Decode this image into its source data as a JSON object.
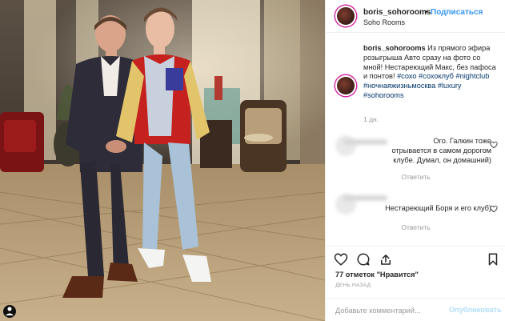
{
  "post_header": {
    "username": "boris_sohorooms",
    "separator": "•",
    "follow_label": "Подписаться",
    "location": "Soho Rooms"
  },
  "caption": {
    "username": "boris_sohorooms",
    "text": "Из прямого эфира розыгрыша Авто сразу на фото со мной! Нестареющий Макс, без пафоса и понтов!",
    "hashtags": [
      "#сохо",
      "#сохоклуб",
      "#nightclub",
      "#ночнаяжизньмосква",
      "#luxury",
      "#sohorooms"
    ],
    "time": "1 дн."
  },
  "comments": [
    {
      "line1": "Ого. Галкин тоже",
      "line2": "отрывается в самом дорогом",
      "line3": "клубе. Думал, он домашний)",
      "reply_label": "Ответить"
    },
    {
      "line1": "Нестареющий Боря и его клуб)",
      "reply_label": "Ответить"
    }
  ],
  "actions": {
    "icons": [
      "heart-icon",
      "comment-icon",
      "share-icon",
      "bookmark-icon"
    ]
  },
  "likes_text": "77 отметок \"Нравится\"",
  "post_date": "ДЕНЬ НАЗАД",
  "add_comment": {
    "placeholder": "Добавьте комментарий...",
    "publish_label": "Опубликовать"
  },
  "colors": {
    "link_blue": "#3897f0",
    "hashtag_blue": "#003569",
    "muted_gray": "#999999",
    "publish_disabled": "#b2dffc"
  }
}
